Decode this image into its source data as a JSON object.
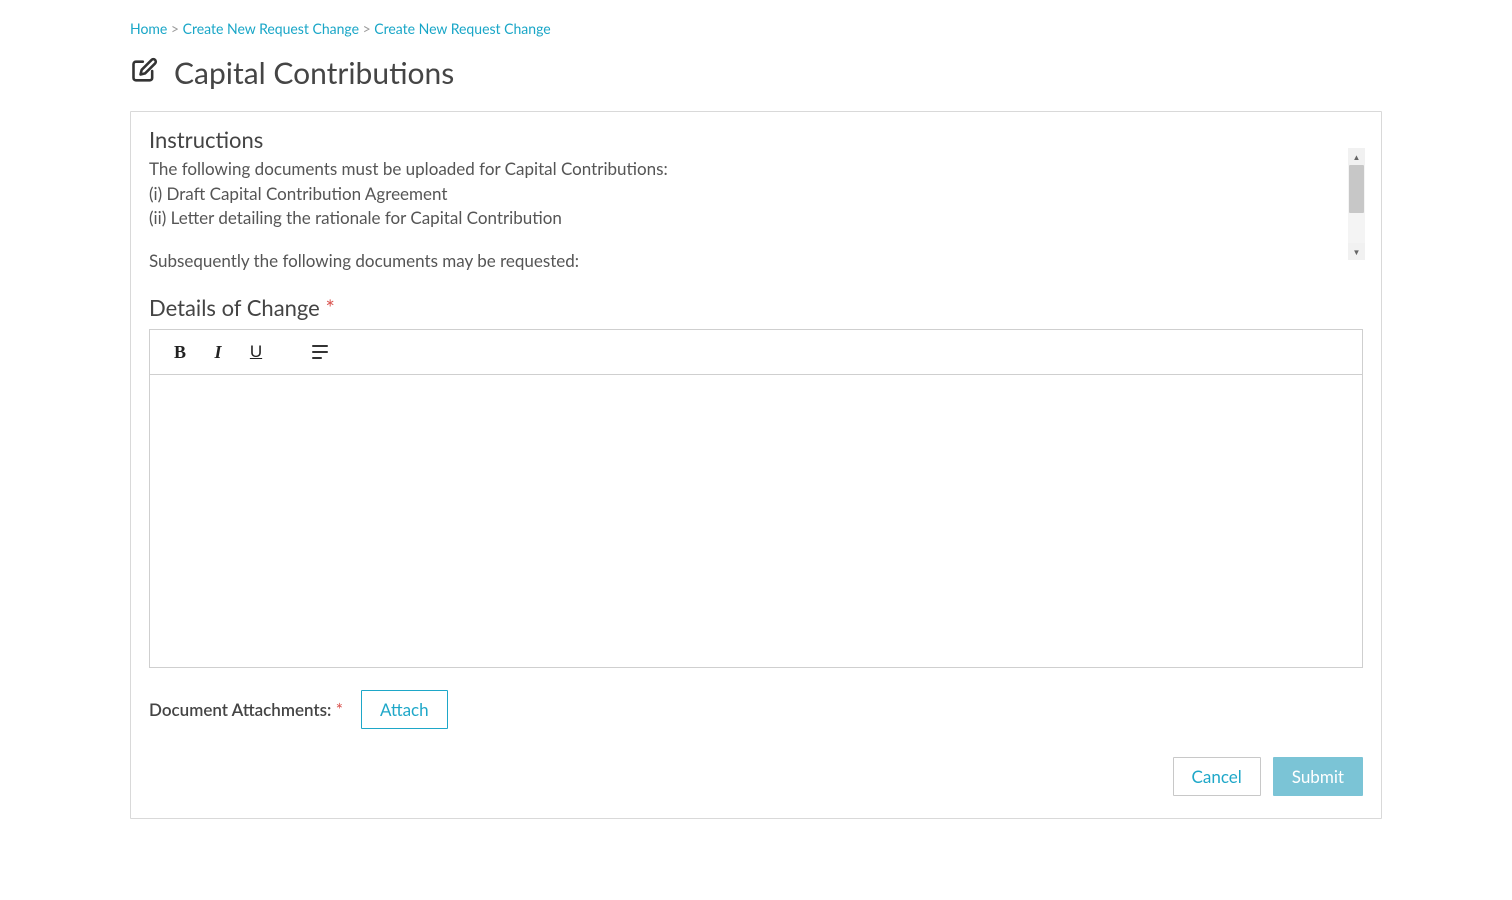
{
  "breadcrumb": {
    "items": [
      {
        "label": "Home"
      },
      {
        "label": "Create New Request Change"
      },
      {
        "label": "Create New Request Change"
      }
    ]
  },
  "page_title": "Capital Contributions",
  "instructions": {
    "heading": "Instructions",
    "intro": "The following documents must be uploaded for Capital Contributions:",
    "item1": "(i) Draft Capital Contribution Agreement",
    "item2": "(ii) Letter detailing the rationale for Capital Contribution",
    "followup": "Subsequently the following documents may be requested:"
  },
  "details_of_change": {
    "label": "Details of Change",
    "value": ""
  },
  "toolbar": {
    "bold": "B",
    "italic": "I",
    "underline": "U"
  },
  "attachments": {
    "label": "Document Attachments:",
    "button": "Attach"
  },
  "actions": {
    "cancel": "Cancel",
    "submit": "Submit"
  }
}
